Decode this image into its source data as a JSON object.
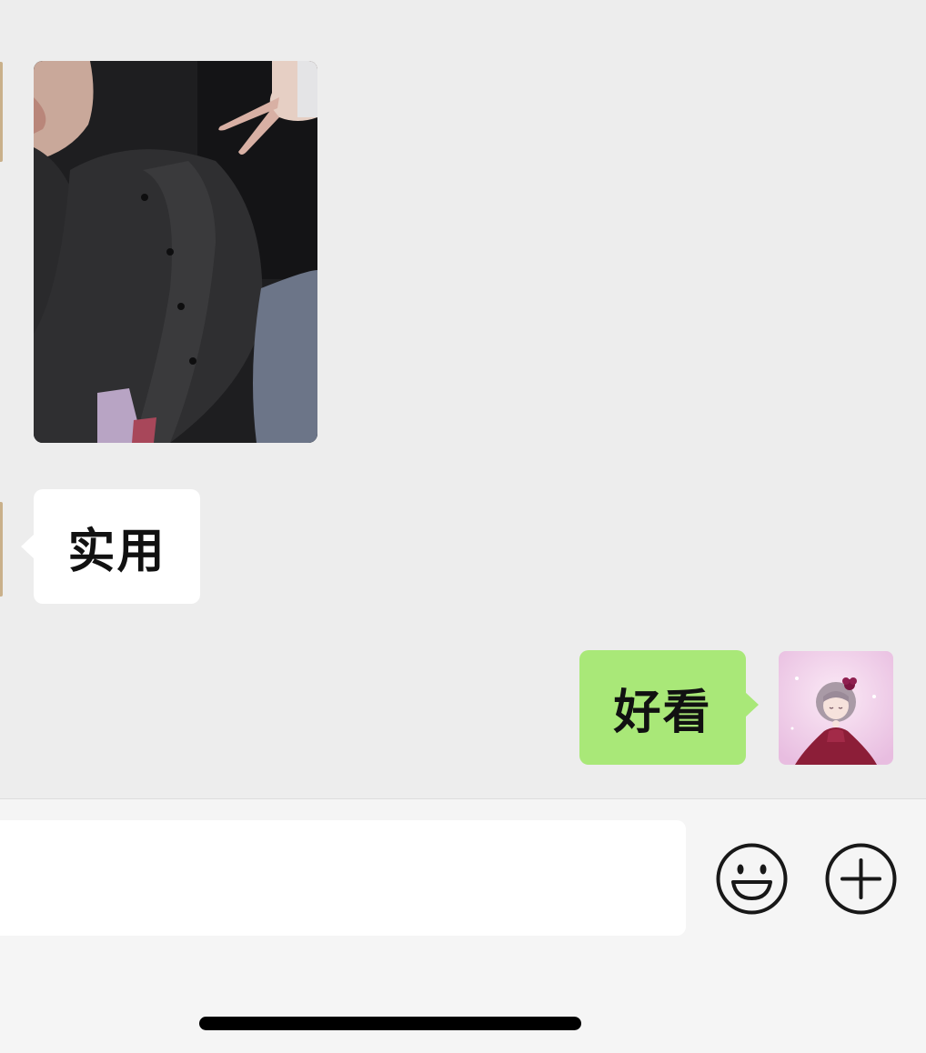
{
  "chat": {
    "messages": [
      {
        "sender": "other",
        "type": "image",
        "icon": "photo-image"
      },
      {
        "sender": "other",
        "type": "text",
        "text": "实用"
      },
      {
        "sender": "me",
        "type": "text",
        "text": "好看"
      }
    ],
    "my_avatar_icon": "cartoon-girl-avatar-icon"
  },
  "input_bar": {
    "message_placeholder": "",
    "emoji_icon": "emoji-smiley-icon",
    "more_icon": "plus-circle-icon"
  },
  "colors": {
    "background": "#EDEDED",
    "received_bubble": "#FFFFFF",
    "sent_bubble": "#A9E878",
    "input_bar": "#F5F5F5"
  }
}
